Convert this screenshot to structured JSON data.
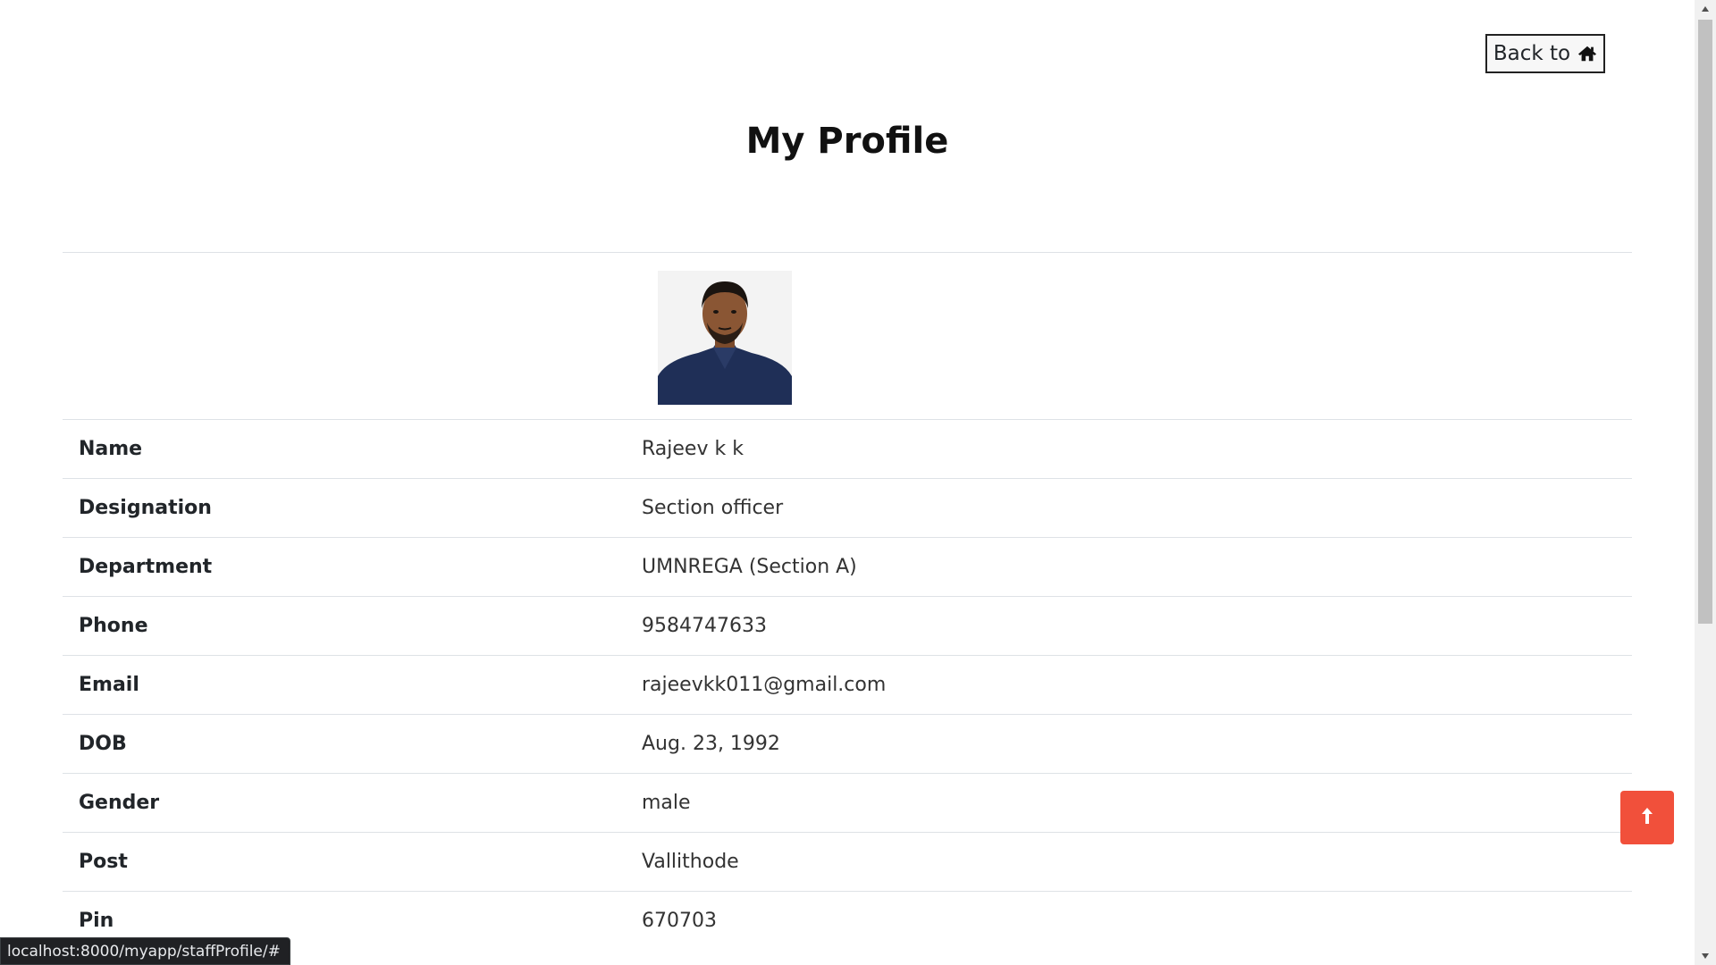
{
  "header": {
    "back_label": "Back to",
    "back_icon": "home-icon"
  },
  "title": "My Profile",
  "profile": {
    "photo_alt": "profile photo",
    "fields": [
      {
        "label": "Name",
        "value": "Rajeev k k"
      },
      {
        "label": "Designation",
        "value": "Section officer"
      },
      {
        "label": "Department",
        "value": "UMNREGA (Section A)"
      },
      {
        "label": "Phone",
        "value": "9584747633"
      },
      {
        "label": "Email",
        "value": "rajeevkk011@gmail.com"
      },
      {
        "label": "DOB",
        "value": "Aug. 23, 1992"
      },
      {
        "label": "Gender",
        "value": "male"
      },
      {
        "label": "Post",
        "value": "Vallithode"
      },
      {
        "label": "Pin",
        "value": "670703"
      }
    ]
  },
  "scroll_top": {
    "icon": "arrow-up-icon",
    "color": "#f1503b"
  },
  "status_bar": {
    "url": "localhost:8000/myapp/staffProfile/#"
  }
}
